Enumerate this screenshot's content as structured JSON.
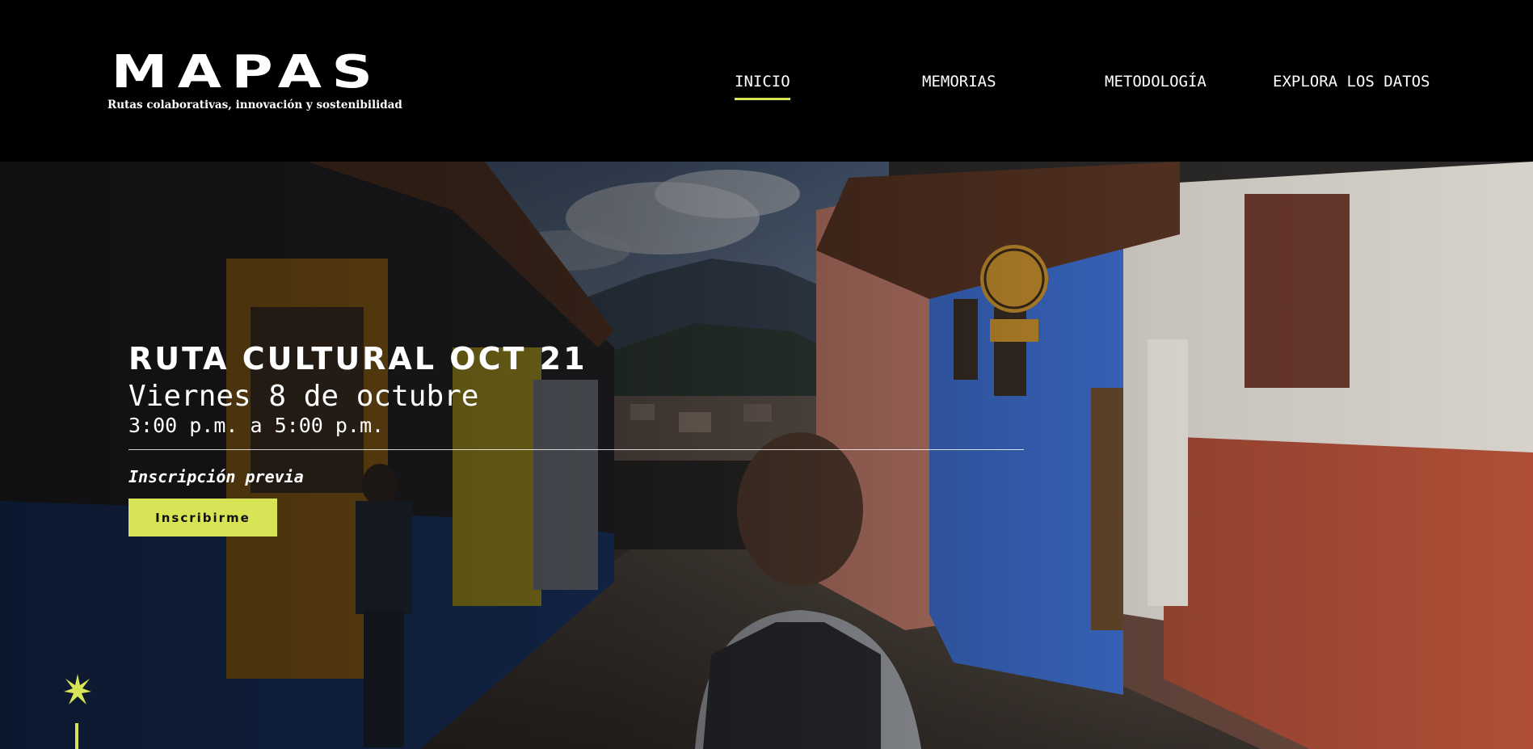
{
  "brand": {
    "title": "MAPAS",
    "tagline": "Rutas colaborativas, innovación y sostenibilidad"
  },
  "nav": {
    "items": [
      {
        "label": "INICIO",
        "active": true
      },
      {
        "label": "MEMORIAS",
        "active": false
      },
      {
        "label": "METODOLOGÍA",
        "active": false
      },
      {
        "label": "EXPLORA LOS DATOS",
        "active": false
      }
    ]
  },
  "event": {
    "title": "RUTA CULTURAL OCT 21",
    "date": "Viernes 8 de octubre",
    "time": "3:00 p.m. a 5:00 p.m.",
    "note": "Inscripción previa",
    "button_label": "Inscribirme"
  },
  "colors": {
    "accent": "#d8e455",
    "header_bg": "#000000",
    "text": "#ffffff"
  },
  "icons": {
    "spark": "spark-icon"
  }
}
